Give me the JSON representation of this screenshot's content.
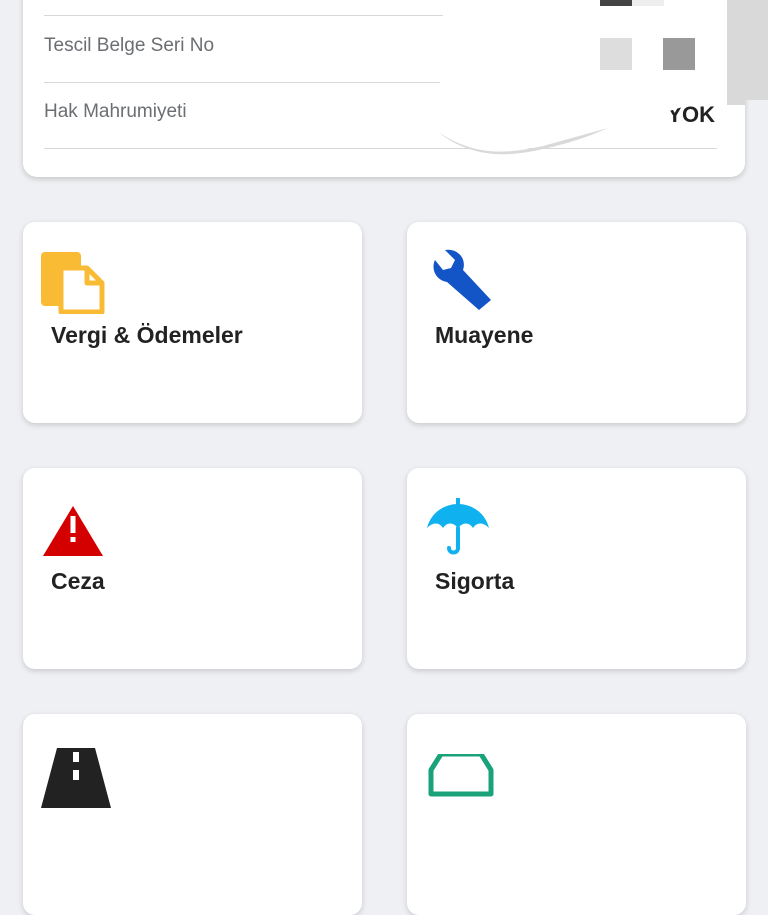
{
  "details": {
    "rows": [
      {
        "label": "Tescil Belge Seri No",
        "value": ""
      },
      {
        "label": "Hak Mahrumiyeti",
        "value": "YOK"
      }
    ]
  },
  "menu": {
    "tiles": [
      {
        "label": "Vergi & Ödemeler",
        "icon": "documents-icon",
        "color": "#f8bb33"
      },
      {
        "label": "Muayene",
        "icon": "wrench-icon",
        "color": "#1354c7"
      },
      {
        "label": "Ceza",
        "icon": "warning-icon",
        "color": "#d40000"
      },
      {
        "label": "Sigorta",
        "icon": "umbrella-icon",
        "color": "#0fb1ef"
      },
      {
        "label": "",
        "icon": "road-icon",
        "color": "#222222"
      },
      {
        "label": "",
        "icon": "car-icon",
        "color": "#1aa37a"
      }
    ]
  }
}
